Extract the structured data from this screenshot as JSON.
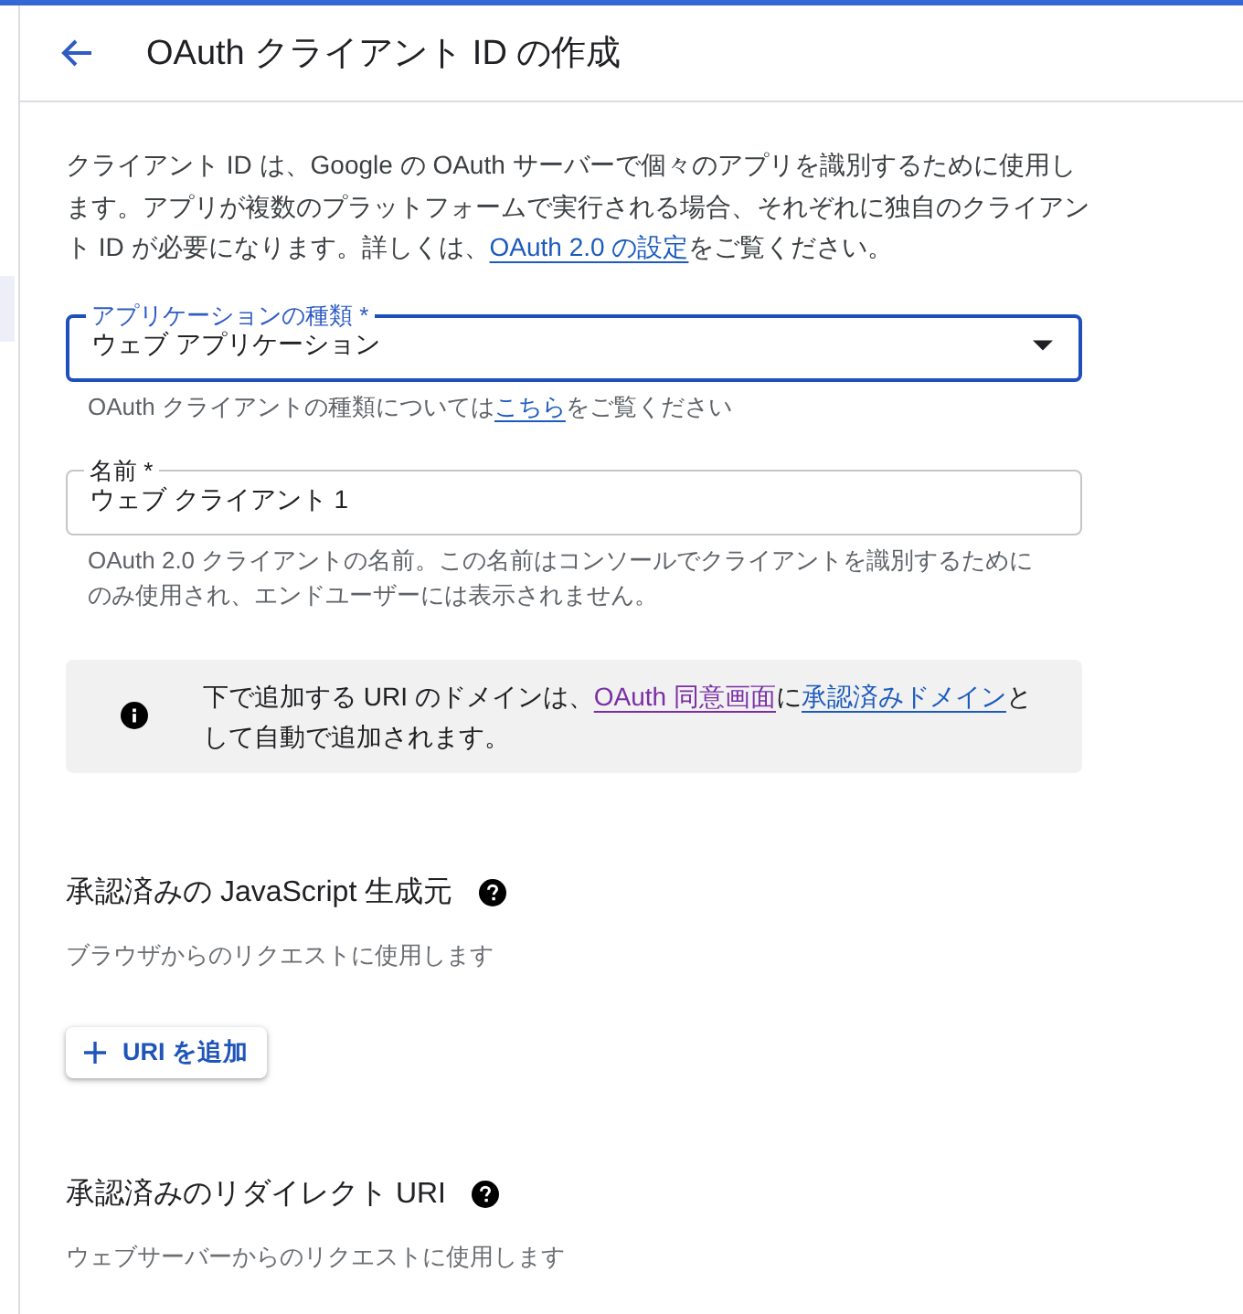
{
  "header": {
    "title": "OAuth クライアント ID の作成"
  },
  "intro": {
    "parts": [
      {
        "kind": "text",
        "text": "クライアント ID は、Google の OAuth サーバーで個々のアプリを識別するために使用します。アプリが複数のプラットフォームで実行される場合、それぞれに独自のクライアント ID が必要になります。詳しくは、"
      },
      {
        "kind": "link",
        "text": "OAuth 2.0 の設定",
        "visited": false
      },
      {
        "kind": "text",
        "text": "をご覧ください。"
      }
    ]
  },
  "fields": [
    {
      "kind": "select",
      "label": "アプリケーションの種類 *",
      "value": "ウェブ アプリケーション",
      "focused": true,
      "helper": {
        "parts": [
          {
            "kind": "text",
            "text": "OAuth クライアントの種類については"
          },
          {
            "kind": "link",
            "text": "こちら",
            "visited": false
          },
          {
            "kind": "text",
            "text": "をご覧ください"
          }
        ]
      }
    },
    {
      "kind": "text",
      "label": "名前 *",
      "value": "ウェブ クライアント 1",
      "focused": false,
      "helper": {
        "parts": [
          {
            "kind": "text",
            "text": "OAuth 2.0 クライアントの名前。この名前はコンソールでクライアントを識別するためにのみ使用され、エンドユーザーには表示されません。"
          }
        ]
      }
    }
  ],
  "notice": {
    "parts": [
      {
        "kind": "text",
        "text": "下で追加する URI のドメインは、"
      },
      {
        "kind": "link",
        "text": "OAuth 同意画面",
        "visited": true
      },
      {
        "kind": "text",
        "text": "に"
      },
      {
        "kind": "link",
        "text": "承認済みドメイン",
        "visited": false
      },
      {
        "kind": "text",
        "text": "として自動で追加されます。"
      }
    ]
  },
  "sections": [
    {
      "title": "承認済みの JavaScript 生成元",
      "description": "ブラウザからのリクエストに使用します",
      "button": "URI を追加"
    },
    {
      "title": "承認済みのリダイレクト URI",
      "description": "ウェブサーバーからのリクエストに使用します"
    }
  ]
}
